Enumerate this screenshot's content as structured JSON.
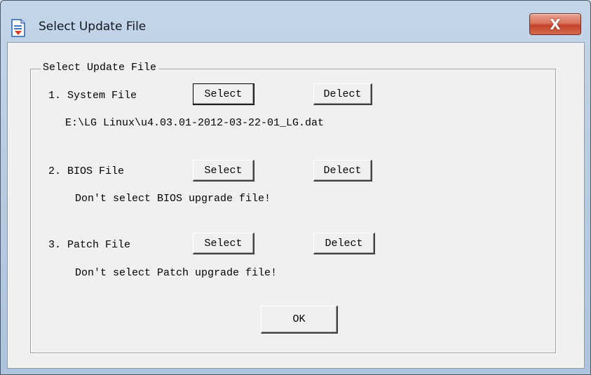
{
  "window": {
    "title": "Select Update File",
    "close_label": "X"
  },
  "group": {
    "legend": "Select Update File"
  },
  "sections": [
    {
      "label": "1. System File",
      "select_label": "Select",
      "delete_label": "Delect",
      "status": "E:\\LG Linux\\u4.03.01-2012-03-22-01_LG.dat"
    },
    {
      "label": "2. BIOS File",
      "select_label": "Select",
      "delete_label": "Delect",
      "status": "Don't select BIOS upgrade file!"
    },
    {
      "label": "3. Patch File",
      "select_label": "Select",
      "delete_label": "Delect",
      "status": "Don't select Patch upgrade file!"
    }
  ],
  "ok_label": "OK",
  "colors": {
    "close_button": "#c4432a",
    "title_bar": "#b9cde2",
    "client_bg": "#f0f0f0"
  },
  "icons": {
    "title": "document-icon"
  }
}
